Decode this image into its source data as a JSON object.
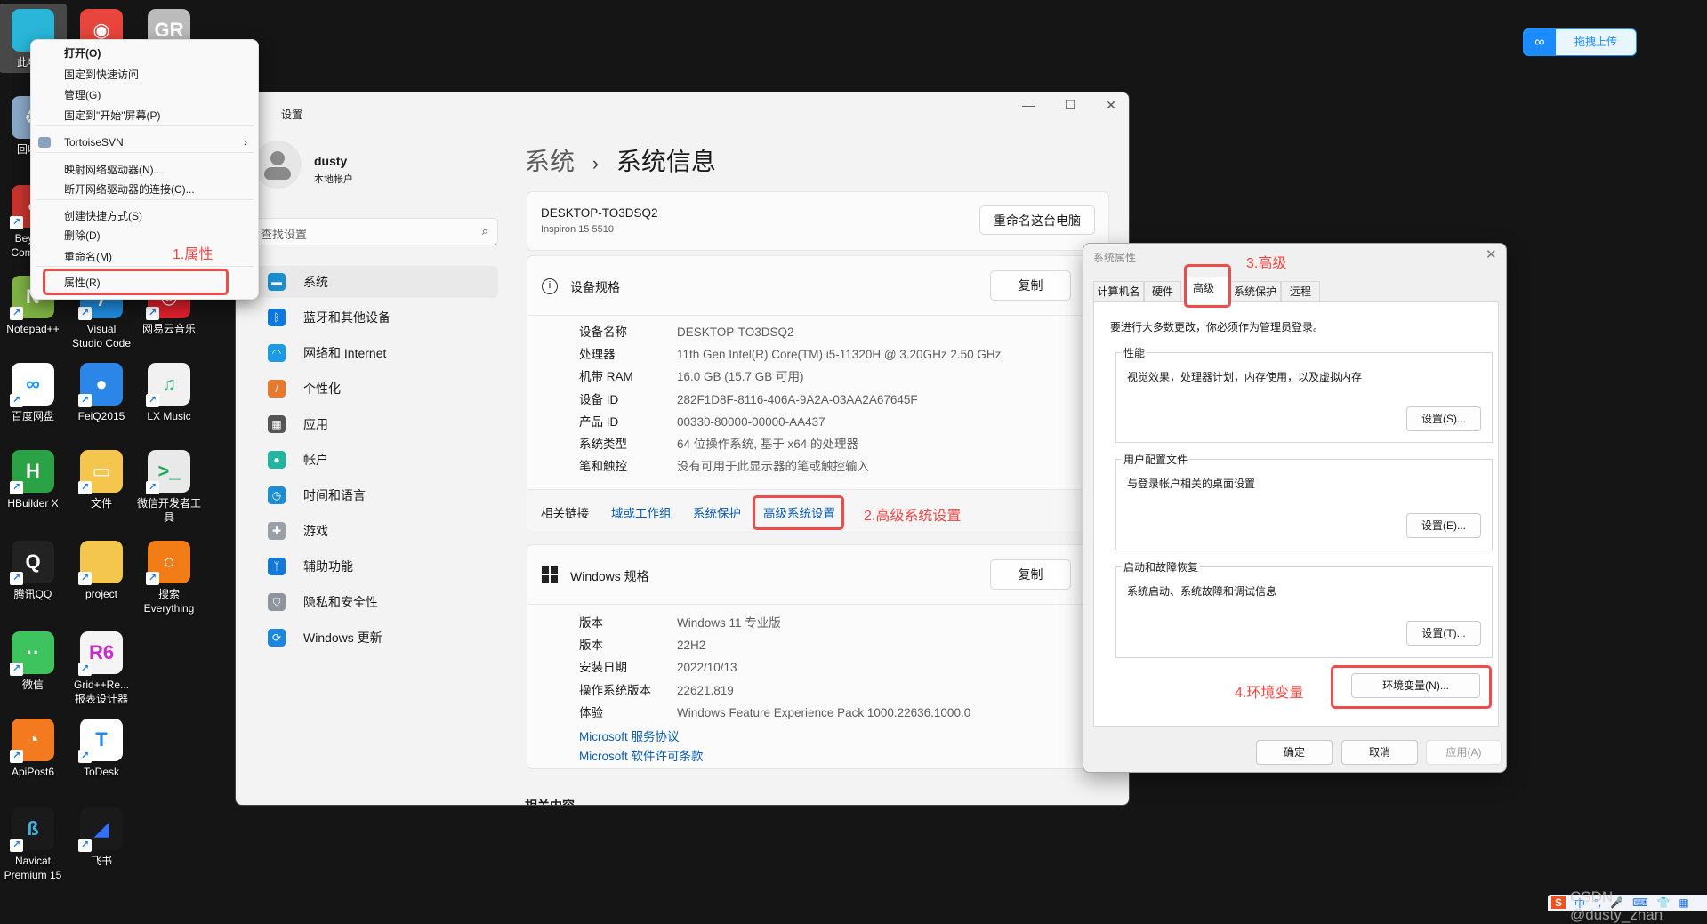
{
  "desktop": {
    "icons": [
      {
        "label": "此电脑",
        "color": "#29b6d8",
        "glyph": "",
        "selected": true
      },
      {
        "label": "",
        "color": "#e8453c",
        "glyph": "◉"
      },
      {
        "label": "",
        "color": "#bbbbbb",
        "glyph": "GR"
      },
      {
        "label": "回收站",
        "color": "#8aa8c8",
        "glyph": "♻"
      },
      {
        "label": "Beyond\nCompare",
        "color": "#c8352f",
        "glyph": "◐"
      },
      {
        "label": "Notepad++",
        "color": "#7fb244",
        "glyph": "N"
      },
      {
        "label": "Visual\nStudio Code",
        "color": "#1f8ad8",
        "glyph": "⟩"
      },
      {
        "label": "网易云音乐",
        "color": "#dd1f2b",
        "glyph": "◎"
      },
      {
        "label": "百度网盘",
        "color": "#ffffff",
        "glyph": "∞",
        "fg": "#2196f3"
      },
      {
        "label": "FeiQ2015",
        "color": "#2b86e8",
        "glyph": "●"
      },
      {
        "label": "LX Music",
        "color": "#f1f1f1",
        "glyph": "♫",
        "fg": "#3fba7a"
      },
      {
        "label": "HBuilder X",
        "color": "#2ba245",
        "glyph": "H"
      },
      {
        "label": "文件",
        "color": "#f5c64e",
        "glyph": "▭"
      },
      {
        "label": "微信开发者工\n具",
        "color": "#e9e9e9",
        "glyph": ">_",
        "fg": "#1aad5a"
      },
      {
        "label": "腾讯QQ",
        "color": "#222222",
        "glyph": "Q"
      },
      {
        "label": "project",
        "color": "#f5c64e",
        "glyph": ""
      },
      {
        "label": "搜索\nEverything",
        "color": "#f27c16",
        "glyph": "○"
      },
      {
        "label": "微信",
        "color": "#3ec45e",
        "glyph": "··"
      },
      {
        "label": "Grid++Re...\n报表设计器",
        "color": "#f4f4f4",
        "glyph": "R6",
        "fg": "#cc2bcc"
      },
      {
        "label": "ApiPost6",
        "color": "#f37a1f",
        "glyph": "◔"
      },
      {
        "label": "ToDesk",
        "color": "#ffffff",
        "glyph": "T",
        "fg": "#1d8cf0"
      },
      {
        "label": "Navicat\nPremium 15",
        "color": "#1a1a1a",
        "glyph": "ß",
        "fg": "#3cb0e0"
      },
      {
        "label": "飞书",
        "color": "#1a1a1a",
        "glyph": "◢",
        "fg": "#3370ff"
      }
    ],
    "shortcut_arrow": "↗"
  },
  "context_menu": {
    "items": [
      {
        "label": "打开(O)",
        "bold": true
      },
      {
        "label": "固定到快速访问"
      },
      {
        "label": "管理(G)"
      },
      {
        "label": "固定到\"开始\"屏幕(P)"
      },
      {
        "label": "TortoiseSVN",
        "submenu": true
      },
      {
        "label": "映射网络驱动器(N)..."
      },
      {
        "label": "断开网络驱动器的连接(C)..."
      },
      {
        "label": "创建快捷方式(S)"
      },
      {
        "label": "删除(D)"
      },
      {
        "label": "重命名(M)"
      },
      {
        "label": "属性(R)"
      }
    ],
    "submenu_chevron": "›"
  },
  "annotations": {
    "step1": "1.属性",
    "step2": "2.高级系统设置",
    "step3": "3.高级",
    "step4": "4.环境变量",
    "color": "#f04747"
  },
  "settings": {
    "title": "设置",
    "user": {
      "name": "dusty",
      "account_type": "本地帐户"
    },
    "search_placeholder": "查找设置",
    "nav": [
      {
        "label": "系统",
        "icon": "system-icon",
        "color": "#1a8fd0",
        "active": true
      },
      {
        "label": "蓝牙和其他设备",
        "icon": "bluetooth-icon",
        "color": "#0a78e0"
      },
      {
        "label": "网络和 Internet",
        "icon": "wifi-icon",
        "color": "#1b9be6"
      },
      {
        "label": "个性化",
        "icon": "brush-icon",
        "color": "#e8792c"
      },
      {
        "label": "应用",
        "icon": "apps-icon",
        "color": "#555555"
      },
      {
        "label": "帐户",
        "icon": "account-icon",
        "color": "#22b5a0"
      },
      {
        "label": "时间和语言",
        "icon": "globe-clock-icon",
        "color": "#1b8fd6"
      },
      {
        "label": "游戏",
        "icon": "gamepad-icon",
        "color": "#9aa0a8"
      },
      {
        "label": "辅助功能",
        "icon": "accessibility-icon",
        "color": "#1478d8"
      },
      {
        "label": "隐私和安全性",
        "icon": "shield-icon",
        "color": "#8e959c"
      },
      {
        "label": "Windows 更新",
        "icon": "update-icon",
        "color": "#1b86e0"
      }
    ],
    "breadcrumb": {
      "parent": "系统",
      "separator": "›",
      "current": "系统信息"
    },
    "device": {
      "name": "DESKTOP-TO3DSQ2",
      "model": "Inspiron 15 5510",
      "rename_button": "重命名这台电脑"
    },
    "device_specs": {
      "title": "设备规格",
      "copy_button": "复制",
      "rows": [
        {
          "key": "设备名称",
          "value": "DESKTOP-TO3DSQ2"
        },
        {
          "key": "处理器",
          "value": "11th Gen Intel(R) Core(TM) i5-11320H @ 3.20GHz   2.50 GHz"
        },
        {
          "key": "机带 RAM",
          "value": "16.0 GB (15.7 GB 可用)"
        },
        {
          "key": "设备 ID",
          "value": "282F1D8F-8116-406A-9A2A-03AA2A67645F"
        },
        {
          "key": "产品 ID",
          "value": "00330-80000-00000-AA437"
        },
        {
          "key": "系统类型",
          "value": "64 位操作系统, 基于 x64 的处理器"
        },
        {
          "key": "笔和触控",
          "value": "没有可用于此显示器的笔或触控输入"
        }
      ]
    },
    "related_links": {
      "label": "相关链接",
      "links": [
        "域或工作组",
        "系统保护",
        "高级系统设置"
      ]
    },
    "windows_specs": {
      "title": "Windows 规格",
      "copy_button": "复制",
      "rows": [
        {
          "key": "版本",
          "value": "Windows 11 专业版"
        },
        {
          "key": "版本",
          "value": "22H2"
        },
        {
          "key": "安装日期",
          "value": "2022/10/13"
        },
        {
          "key": "操作系统版本",
          "value": "22621.819"
        },
        {
          "key": "体验",
          "value": "Windows Feature Experience Pack 1000.22636.1000.0"
        }
      ],
      "links": [
        "Microsoft 服务协议",
        "Microsoft 软件许可条款"
      ]
    },
    "related_content": "相关内容"
  },
  "system_properties": {
    "title": "系统属性",
    "tabs": [
      "计算机名",
      "硬件",
      "高级",
      "系统保护",
      "远程"
    ],
    "active_tab": "高级",
    "admin_note": "要进行大多数更改，你必须作为管理员登录。",
    "groups": [
      {
        "title": "性能",
        "desc": "视觉效果，处理器计划，内存使用，以及虚拟内存",
        "button": "设置(S)..."
      },
      {
        "title": "用户配置文件",
        "desc": "与登录帐户相关的桌面设置",
        "button": "设置(E)..."
      },
      {
        "title": "启动和故障恢复",
        "desc": "系统启动、系统故障和调试信息",
        "button": "设置(T)..."
      }
    ],
    "env_button": "环境变量(N)...",
    "ok": "确定",
    "cancel": "取消",
    "apply": "应用(A)"
  },
  "upload_widget": {
    "label": "拖拽上传"
  },
  "watermark": "CSDN @dusty_zhan",
  "ime_bar": {
    "items": [
      "S",
      "中",
      "°,",
      "🎤",
      "⌨",
      "👕",
      "▦"
    ]
  }
}
